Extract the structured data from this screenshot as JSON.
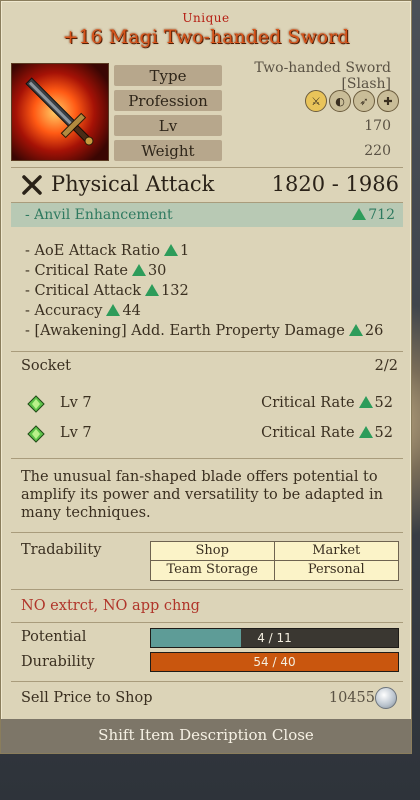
{
  "item": {
    "rarity": "Unique",
    "name": "+16 Magi Two-handed Sword"
  },
  "properties": {
    "type_label": "Type",
    "type_value": "Two-handed Sword [Slash]",
    "profession_label": "Profession",
    "profession_icons": [
      "sword-class-icon",
      "shield-class-icon",
      "bow-class-icon",
      "cross-class-icon"
    ],
    "lv_label": "Lv",
    "lv_value": "170",
    "weight_label": "Weight",
    "weight_value": "220"
  },
  "attack": {
    "label": "Physical Attack",
    "value": "1820 - 1986"
  },
  "anvil": {
    "label": "- Anvil Enhancement",
    "value": "712"
  },
  "stats": [
    {
      "label": "- AoE Attack Ratio",
      "value": "1"
    },
    {
      "label": "- Critical Rate",
      "value": "30"
    },
    {
      "label": "- Critical Attack",
      "value": "132"
    },
    {
      "label": "- Accuracy",
      "value": "44"
    },
    {
      "label": "- [Awakening] Add. Earth Property Damage",
      "value": "26"
    }
  ],
  "socket": {
    "label": "Socket",
    "count": "2/2",
    "gems": [
      {
        "lv": "Lv 7",
        "stat": "Critical Rate",
        "value": "52"
      },
      {
        "lv": "Lv 7",
        "stat": "Critical Rate",
        "value": "52"
      }
    ]
  },
  "description": "The unusual fan-shaped blade offers potential to amplify its power and versatility to be adapted in many techniques.",
  "tradability": {
    "label": "Tradability",
    "cells": [
      "Shop",
      "Market",
      "Team Storage",
      "Personal"
    ]
  },
  "restriction": "NO extrct, NO app chng",
  "potential": {
    "label": "Potential",
    "text": "4 / 11",
    "fraction": 0.3636
  },
  "durability": {
    "label": "Durability",
    "text": "54 / 40",
    "fraction": 1.0
  },
  "sell": {
    "label": "Sell Price to Shop",
    "value": "10455"
  },
  "footer": "Shift Item Description Close",
  "colors": {
    "name": "#d8541b",
    "rarity": "#b51d12",
    "anvil": "#2f7a60",
    "potential_fill": "#5e9c97",
    "durability_fill": "#c9560e",
    "warning": "#b0352a"
  }
}
